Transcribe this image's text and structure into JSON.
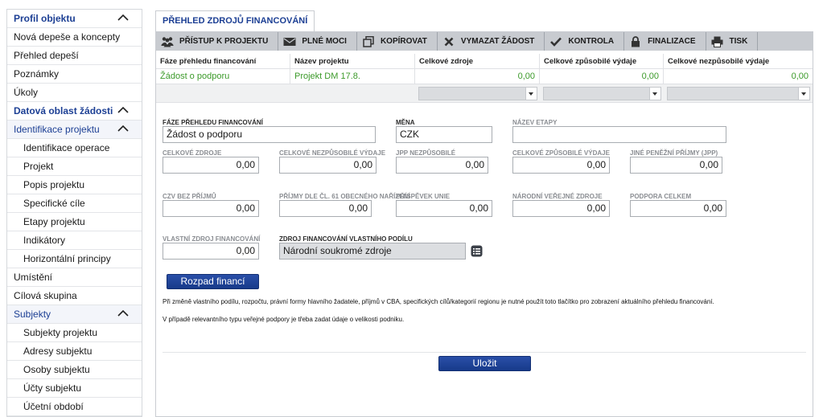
{
  "sidebar": {
    "items": [
      {
        "label": "Profil objektu",
        "kind": "head",
        "chevron": true
      },
      {
        "label": "Nová depeše a koncepty",
        "kind": "item"
      },
      {
        "label": "Přehled depeší",
        "kind": "item"
      },
      {
        "label": "Poznámky",
        "kind": "item"
      },
      {
        "label": "Úkoly",
        "kind": "item"
      },
      {
        "label": "Datová oblast žádosti",
        "kind": "head",
        "chevron": true
      },
      {
        "label": "Identifikace projektu",
        "kind": "head-light",
        "chevron": true
      },
      {
        "label": "Identifikace operace",
        "kind": "sub"
      },
      {
        "label": "Projekt",
        "kind": "sub"
      },
      {
        "label": "Popis projektu",
        "kind": "sub"
      },
      {
        "label": "Specifické cíle",
        "kind": "sub"
      },
      {
        "label": "Etapy projektu",
        "kind": "sub"
      },
      {
        "label": "Indikátory",
        "kind": "sub"
      },
      {
        "label": "Horizontální principy",
        "kind": "sub"
      },
      {
        "label": "Umístění",
        "kind": "item"
      },
      {
        "label": "Cílová skupina",
        "kind": "item"
      },
      {
        "label": "Subjekty",
        "kind": "head-light",
        "chevron": true
      },
      {
        "label": "Subjekty projektu",
        "kind": "sub"
      },
      {
        "label": "Adresy subjektu",
        "kind": "sub"
      },
      {
        "label": "Osoby subjektu",
        "kind": "sub"
      },
      {
        "label": "Účty subjektu",
        "kind": "sub"
      },
      {
        "label": "Účetní období",
        "kind": "sub"
      }
    ]
  },
  "tab": {
    "label": "PŘEHLED ZDROJŮ FINANCOVÁNÍ"
  },
  "toolbar": {
    "buttons": [
      {
        "label": "PŘÍSTUP K PROJEKTU",
        "icon": "users-icon"
      },
      {
        "label": "PLNÉ MOCI",
        "icon": "envelope-icon"
      },
      {
        "label": "KOPÍROVAT",
        "icon": "copy-icon"
      },
      {
        "label": "VYMAZAT ŽÁDOST",
        "icon": "cross-icon"
      },
      {
        "label": "KONTROLA",
        "icon": "check-icon"
      },
      {
        "label": "FINALIZACE",
        "icon": "lock-icon"
      },
      {
        "label": "TISK",
        "icon": "print-icon"
      }
    ]
  },
  "grid": {
    "headers": [
      "Fáze přehledu financování",
      "Název projektu",
      "Celkové zdroje",
      "Celkové způsobilé výdaje",
      "Celkové nezpůsobilé výdaje"
    ],
    "row": [
      "Žádost o podporu",
      "Projekt DM 17.8.",
      "0,00",
      "0,00",
      "0,00"
    ]
  },
  "form": {
    "faze_label": "FÁZE PŘEHLEDU FINANCOVÁNÍ",
    "faze_value": "Žádost o podporu",
    "mena_label": "MĚNA",
    "mena_value": "CZK",
    "etapa_label": "NÁZEV ETAPY",
    "etapa_value": "",
    "celkove_zdroje_label": "CELKOVÉ ZDROJE",
    "celkove_zdroje_value": "0,00",
    "nezpusobile_label": "CELKOVÉ NEZPŮSOBILÉ VÝDAJE",
    "nezpusobile_value": "0,00",
    "jpp_nezp_label": "JPP NEZPŮSOBILÉ",
    "jpp_nezp_value": "0,00",
    "zpusobile_label": "CELKOVÉ ZPŮSOBILÉ VÝDAJE",
    "zpusobile_value": "0,00",
    "jine_label": "JINÉ PENĚŽNÍ PŘÍJMY (JPP)",
    "jine_value": "0,00",
    "czv_label": "CZV BEZ PŘÍJMŮ",
    "czv_value": "0,00",
    "prijmy61_label": "PŘÍJMY DLE ČL. 61 OBECNÉHO NAŘÍZENÍ",
    "prijmy61_value": "0,00",
    "unie_label": "PŘÍSPĚVEK UNIE",
    "unie_value": "0,00",
    "narodni_label": "NÁRODNÍ VEŘEJNÉ ZDROJE",
    "narodni_value": "0,00",
    "podpora_label": "PODPORA CELKEM",
    "podpora_value": "0,00",
    "vlastni_label": "VLASTNÍ ZDROJ FINANCOVÁNÍ",
    "vlastni_value": "0,00",
    "zdroj_label": "ZDROJ FINANCOVÁNÍ VLASTNÍHO PODÍLU",
    "zdroj_value": "Národní soukromé zdroje",
    "rozpad_button": "Rozpad financí",
    "note1": "Při změně vlastního podílu, rozpočtu, právní formy hlavního žadatele, příjmů v CBA, specifických cílů/kategorií regionu je nutné použít toto tlačítko pro zobrazení aktuálního přehledu financování.",
    "note2": "V případě relevantního typu veřejné podpory je třeba zadat údaje o velikosti podniku.",
    "save_button": "Uložit"
  },
  "colors": {
    "accent": "#1c3f94",
    "green_value": "#3c9a2a",
    "toolbar": "#c8cbd0"
  }
}
